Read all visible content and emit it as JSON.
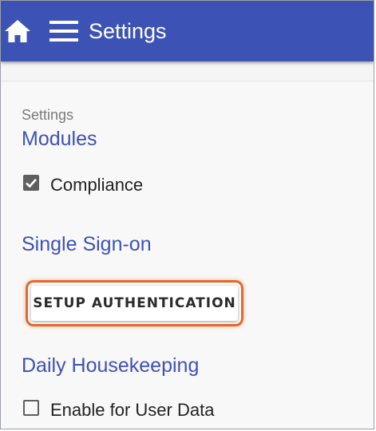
{
  "appbar": {
    "title": "Settings",
    "color": "#3c53b5",
    "home_icon": "home-icon",
    "menu_icon": "hamburger-menu-icon"
  },
  "settings": {
    "section_label": "Settings",
    "modules": {
      "heading": "Modules",
      "compliance": {
        "label": "Compliance",
        "checked": true
      }
    },
    "sso": {
      "heading": "Single Sign-on",
      "setup_button_label": "SETUP AUTHENTICATION",
      "highlight_color": "#e06a2b"
    },
    "housekeeping": {
      "heading": "Daily Housekeeping",
      "user_data": {
        "label": "Enable for User Data",
        "checked": false
      }
    }
  },
  "colors": {
    "heading": "#3f51b5",
    "checkbox": "#5f5f5f"
  }
}
